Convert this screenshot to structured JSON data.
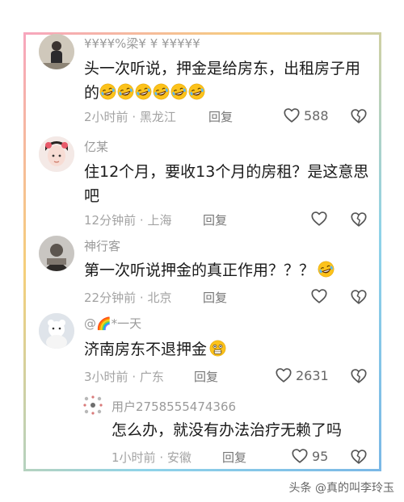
{
  "comments": [
    {
      "username": "¥¥¥¥%梁¥ ¥ ¥¥¥¥¥",
      "text": "头一次听说，押金是给房东，出租房子用的",
      "emoji_count": 6,
      "time": "2小时前",
      "location": "黑龙江",
      "reply_label": "回复",
      "likes": "588"
    },
    {
      "username": "亿某",
      "text": "住12个月，要收13个月的房租？是这意思吧",
      "time": "12分钟前",
      "location": "上海",
      "reply_label": "回复",
      "likes": ""
    },
    {
      "username": "神行客",
      "text": "第一次听说押金的真正作用？？？",
      "emoji_count": 1,
      "time": "22分钟前",
      "location": "北京",
      "reply_label": "回复",
      "likes": ""
    },
    {
      "username": "@🌈*一天",
      "text": "济南房东不退押金",
      "time": "3小时前",
      "location": "广东",
      "reply_label": "回复",
      "likes": "2631"
    },
    {
      "username": "用户2758555474366",
      "text": "怎么办，就没有办法治疗无赖了吗",
      "time": "1小时前",
      "location": "安徽",
      "reply_label": "回复",
      "likes": "95"
    }
  ],
  "separator": "·",
  "watermark": "头条 @真的叫李玲玉",
  "colors": {
    "like_icon": "#555555",
    "meta_text": "#a3a3a3",
    "emoji_face": "#fcc21b"
  },
  "icons": {
    "like": "heart-outline-icon",
    "dislike": "broken-heart-icon",
    "laugh": "rolling-laughing-emoji",
    "shocked": "shocked-emoji"
  }
}
